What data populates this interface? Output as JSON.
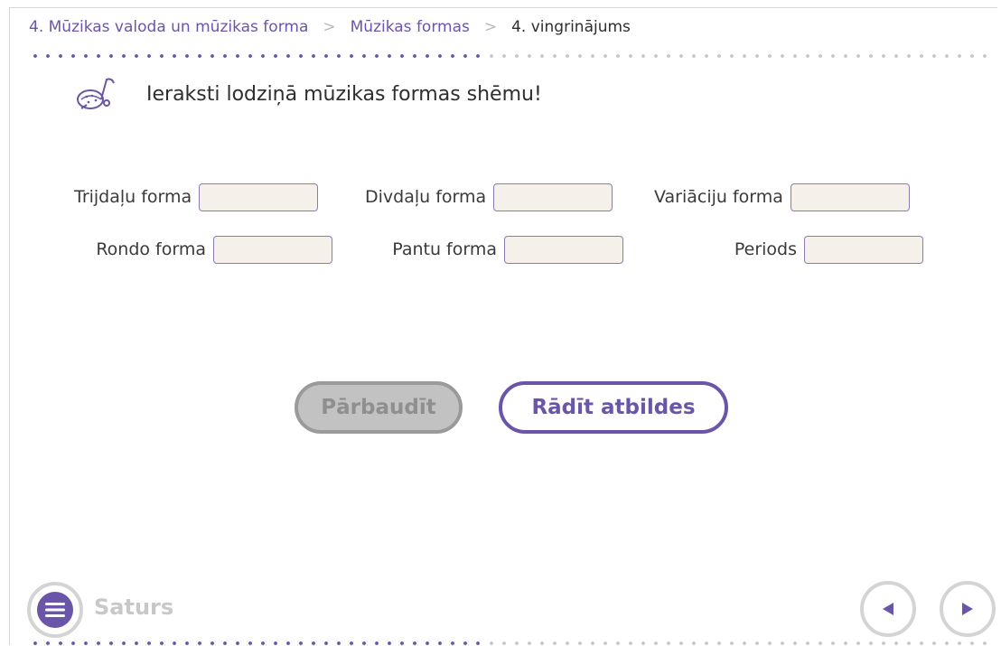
{
  "breadcrumb": {
    "items": [
      "4. Mūzikas valoda un mūzikas forma",
      "Mūzikas formas"
    ],
    "separator": ">",
    "current": "4. vingrinājums"
  },
  "instruction": {
    "text": "Ieraksti lodziņā mūzikas formas shēmu!",
    "icon": "music-note-icon"
  },
  "fields": [
    {
      "label": "Trijdaļu forma",
      "value": ""
    },
    {
      "label": "Divdaļu forma",
      "value": ""
    },
    {
      "label": "Variāciju forma",
      "value": ""
    },
    {
      "label": "Rondo forma",
      "value": ""
    },
    {
      "label": "Pantu forma",
      "value": ""
    },
    {
      "label": "Periods",
      "value": ""
    }
  ],
  "buttons": {
    "check_label": "Pārbaudīt",
    "show_answers_label": "Rādīt atbildes"
  },
  "footer": {
    "menu_label": "Saturs",
    "menu_icon": "hamburger-menu-icon",
    "prev_icon": "arrow-left-icon",
    "next_icon": "arrow-right-icon"
  },
  "colors": {
    "accent": "#6b55a8",
    "input_bg": "#f5f0ea",
    "disabled": "#c2c2c2"
  }
}
